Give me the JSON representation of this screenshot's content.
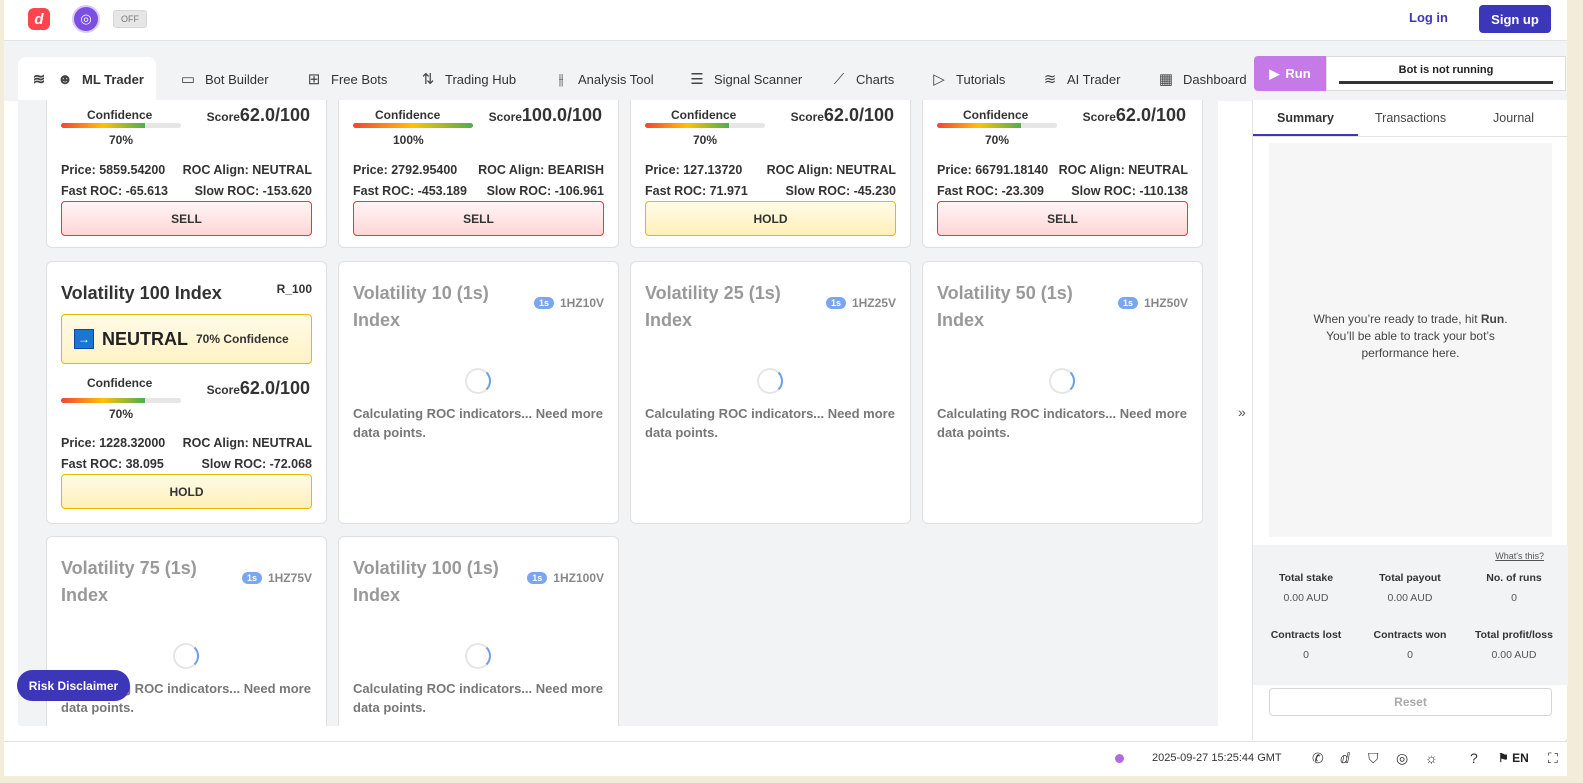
{
  "header": {
    "off_label": "OFF",
    "login": "Log in",
    "signup": "Sign up"
  },
  "nav": {
    "tabs": [
      {
        "label": "ML Trader"
      },
      {
        "label": "Bot Builder"
      },
      {
        "label": "Free Bots"
      },
      {
        "label": "Trading Hub"
      },
      {
        "label": "Analysis Tool"
      },
      {
        "label": "Signal Scanner"
      },
      {
        "label": "Charts"
      },
      {
        "label": "Tutorials"
      },
      {
        "label": "AI Trader"
      },
      {
        "label": "Dashboard"
      }
    ],
    "run": "Run",
    "bot_status": "Bot is not running"
  },
  "cards": {
    "c1": {
      "confidence_label": "Confidence",
      "pct": "70%",
      "score_label": "Score",
      "score": "62.0/100",
      "price": "Price: 5859.54200",
      "align": "ROC Align: NEUTRAL",
      "fast": "Fast ROC: -65.613",
      "slow": "Slow ROC: -153.620",
      "action": "SELL",
      "confidence": 0.7
    },
    "c2": {
      "confidence_label": "Confidence",
      "pct": "100%",
      "score_label": "Score",
      "score": "100.0/100",
      "price": "Price: 2792.95400",
      "align": "ROC Align: BEARISH",
      "fast": "Fast ROC: -453.189",
      "slow": "Slow ROC: -106.961",
      "action": "SELL",
      "confidence": 1.0
    },
    "c3": {
      "confidence_label": "Confidence",
      "pct": "70%",
      "score_label": "Score",
      "score": "62.0/100",
      "price": "Price: 127.13720",
      "align": "ROC Align: NEUTRAL",
      "fast": "Fast ROC: 71.971",
      "slow": "Slow ROC: -45.230",
      "action": "HOLD",
      "confidence": 0.7
    },
    "c4": {
      "confidence_label": "Confidence",
      "pct": "70%",
      "score_label": "Score",
      "score": "62.0/100",
      "price": "Price: 66791.18140",
      "align": "ROC Align: NEUTRAL",
      "fast": "Fast ROC: -23.309",
      "slow": "Slow ROC: -110.138",
      "action": "SELL",
      "confidence": 0.7
    },
    "v100": {
      "title": "Volatility 100 Index",
      "symbol": "R_100",
      "signal": "NEUTRAL",
      "signal_conf": "70% Confidence",
      "confidence_label": "Confidence",
      "pct": "70%",
      "score_label": "Score",
      "score": "62.0/100",
      "price": "Price: 1228.32000",
      "align": "ROC Align: NEUTRAL",
      "fast": "Fast ROC: 38.095",
      "slow": "Slow ROC: -72.068",
      "action": "HOLD",
      "confidence": 0.7
    },
    "v10": {
      "title": "Volatility 10 (1s) Index",
      "badge": "1s",
      "symbol": "1HZ10V",
      "msg": "Calculating ROC indicators... Need more data points."
    },
    "v25": {
      "title": "Volatility 25 (1s) Index",
      "badge": "1s",
      "symbol": "1HZ25V",
      "msg": "Calculating ROC indicators... Need more data points."
    },
    "v50": {
      "title": "Volatility 50 (1s) Index",
      "badge": "1s",
      "symbol": "1HZ50V",
      "msg": "Calculating ROC indicators... Need more data points."
    },
    "v75": {
      "title": "Volatility 75 (1s) Index",
      "badge": "1s",
      "symbol": "1HZ75V",
      "msg": "Calculating ROC indicators... Need more data points."
    },
    "v100s": {
      "title": "Volatility 100 (1s) Index",
      "badge": "1s",
      "symbol": "1HZ100V",
      "msg": "Calculating ROC indicators... Need more data points."
    }
  },
  "panel": {
    "tabs": [
      "Summary",
      "Transactions",
      "Journal"
    ],
    "placeholder_pre": "When you’re ready to trade, hit ",
    "placeholder_bold": "Run",
    "placeholder_post": ". You’ll be able to track your bot’s performance here.",
    "whats_this": "What's this?",
    "stats": [
      {
        "label": "Total stake",
        "value": "0.00 AUD"
      },
      {
        "label": "Total payout",
        "value": "0.00 AUD"
      },
      {
        "label": "No. of runs",
        "value": "0"
      },
      {
        "label": "Contracts lost",
        "value": "0"
      },
      {
        "label": "Contracts won",
        "value": "0"
      },
      {
        "label": "Total profit/loss",
        "value": "0.00 AUD"
      }
    ],
    "reset": "Reset"
  },
  "risk": "Risk Disclaimer",
  "footer": {
    "time": "2025-09-27 15:25:44 GMT",
    "lang": "EN"
  },
  "colors": {
    "brand": "#3b37b8",
    "run": "#c67ae8",
    "sell_border": "#e53935",
    "hold_border": "#e8b800"
  }
}
